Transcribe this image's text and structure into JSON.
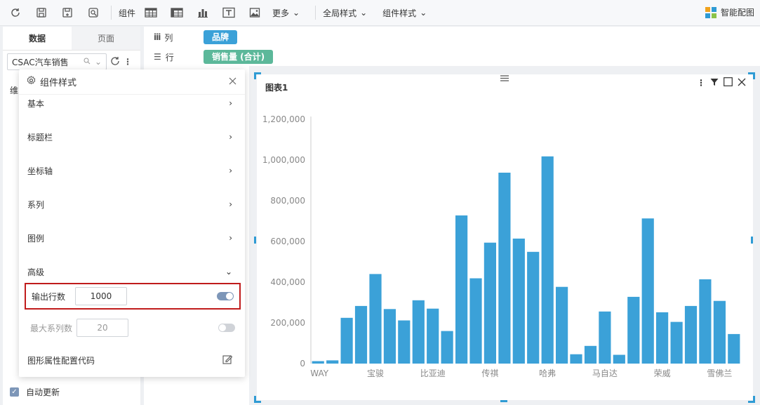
{
  "toolbar": {
    "component_label": "组件",
    "more_label": "更多",
    "global_style_label": "全局样式",
    "component_style_label": "组件样式",
    "smart_config_label": "智能配图"
  },
  "left_panel": {
    "tabs": [
      "数据",
      "页面"
    ],
    "dataset_name": "CSAC汽车销售",
    "dim_label_partial": "维",
    "auto_update_label": "自动更新"
  },
  "shelf": {
    "column_label": "列",
    "row_label": "行",
    "column_pill": "品牌",
    "row_pill": "销售量 (合计)",
    "column_pill_color": "#3ba1d8",
    "row_pill_color": "#5cb89a"
  },
  "popup": {
    "title": "组件样式",
    "menu": [
      "基本",
      "标题栏",
      "坐标轴",
      "系列",
      "图例"
    ],
    "advanced_label": "高级",
    "output_rows_label": "输出行数",
    "output_rows_value": "1000",
    "max_series_label": "最大系列数",
    "max_series_value": "20",
    "code_label": "图形属性配置代码"
  },
  "chart_data": {
    "type": "bar",
    "title": "图表1",
    "bar_color": "#3ba1d8",
    "ylim": [
      0,
      1200000
    ],
    "yticks": [
      "0",
      "200,000",
      "400,000",
      "600,000",
      "800,000",
      "1,000,000",
      "1,200,000"
    ],
    "xtick_labels": [
      "WAY",
      "宝骏",
      "比亚迪",
      "传祺",
      "哈弗",
      "马自达",
      "荣威",
      "雪佛兰"
    ],
    "values": [
      12000,
      16000,
      225000,
      283000,
      440000,
      268000,
      212000,
      311000,
      270000,
      160000,
      728000,
      419000,
      594000,
      938000,
      614000,
      549000,
      1018000,
      377000,
      46000,
      87000,
      256000,
      43000,
      328000,
      713000,
      252000,
      205000,
      283000,
      414000,
      308000,
      145000
    ],
    "grid": false
  }
}
